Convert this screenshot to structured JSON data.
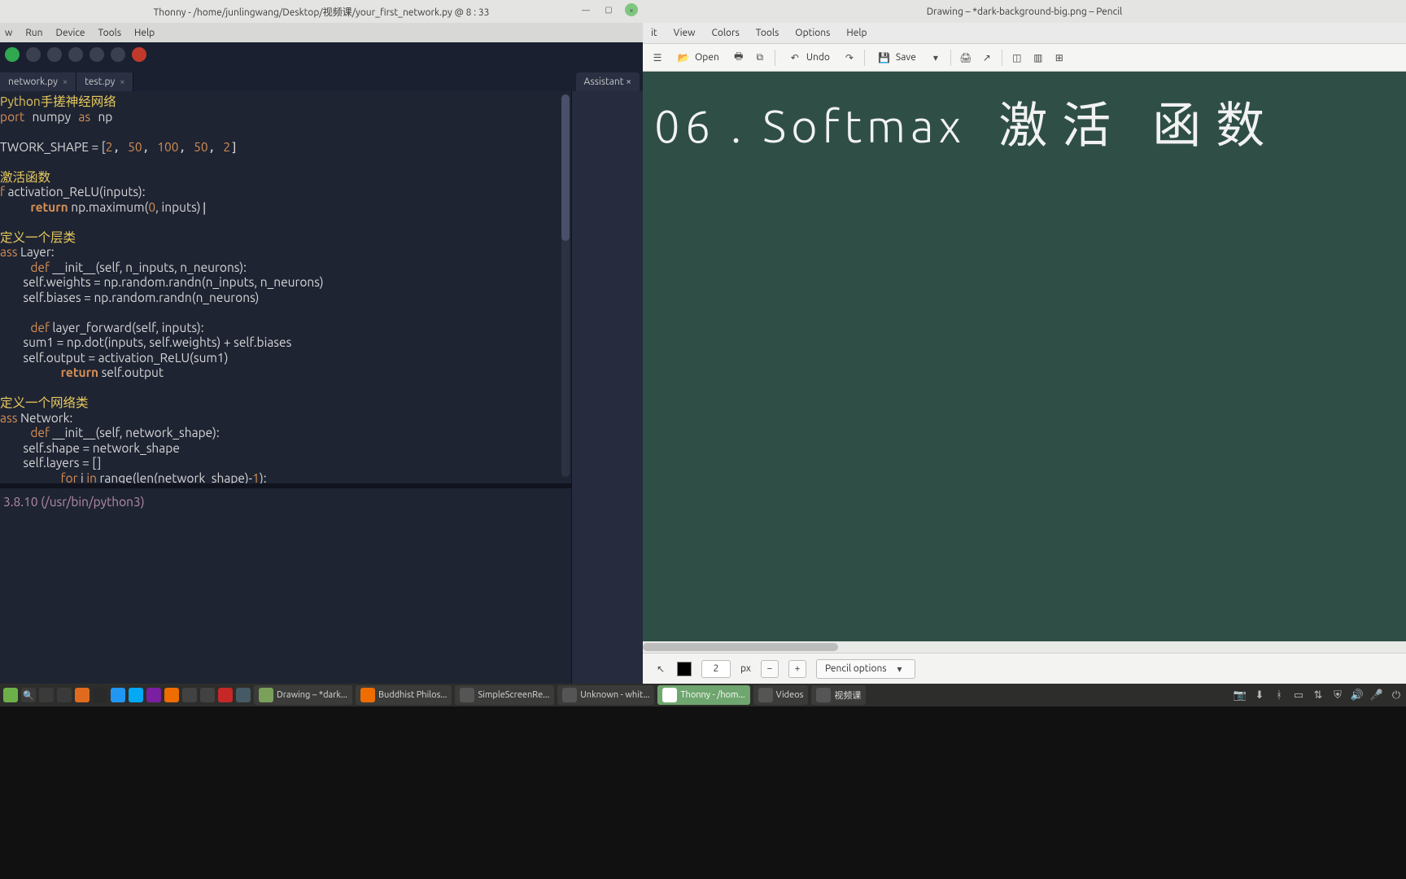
{
  "thonny": {
    "title": "Thonny  -  /home/junlingwang/Desktop/视频课/your_first_network.py  @  8 : 33",
    "menu": [
      "w",
      "Run",
      "Device",
      "Tools",
      "Help"
    ],
    "tabs": [
      {
        "label": "network.py",
        "closable": true
      },
      {
        "label": "test.py",
        "closable": true
      }
    ],
    "assistant_label": "Assistant",
    "code": {
      "l1_cmt": "Python手搓神经网络",
      "l2_a": "port",
      "l2_b": "numpy",
      "l2_c": "as",
      "l2_d": "np",
      "l3_a": "TWORK_SHAPE = [",
      "l3_n1": "2",
      "l3_n2": "50",
      "l3_n3": "100",
      "l3_n4": "50",
      "l3_n5": "2",
      "l4_cmt": "激活函数",
      "l5_a": "f",
      "l5_b": " activation_ReLU(inputs):",
      "l6_a": "return",
      "l6_b": " np.maximum(",
      "l6_n": "0",
      "l6_c": ", inputs)",
      "l7_cmt": "定义一个层类",
      "l8_a": "ass",
      "l8_b": " Layer:",
      "l9_a": "def",
      "l9_b": " __init__(self, n_inputs, n_neurons):",
      "l10": "        self.weights = np.random.randn(n_inputs, n_neurons)",
      "l11": "        self.biases = np.random.randn(n_neurons)",
      "l12_a": "def",
      "l12_b": " layer_forward(self, inputs):",
      "l13": "        sum1 = np.dot(inputs, self.weights) + self.biases",
      "l14": "        self.output = activation_ReLU(sum1)",
      "l15_a": "return",
      "l15_b": " self.output",
      "l16_cmt": "定义一个网络类",
      "l17_a": "ass",
      "l17_b": " Network:",
      "l18_a": "def",
      "l18_b": " __init__(self, network_shape):",
      "l19": "        self.shape = network_shape",
      "l20": "        self.layers = []",
      "l21_a": "for",
      "l21_b": " i ",
      "l21_c": "in",
      "l21_d": " range(len(network_shape)-",
      "l21_n": "1",
      "l21_e": "):"
    },
    "shell": "3.8.10 (/usr/bin/python3)"
  },
  "pencil": {
    "title": "Drawing – *dark-background-big.png – Pencil",
    "menu": [
      "it",
      "View",
      "Colors",
      "Tools",
      "Options",
      "Help"
    ],
    "toolbar": {
      "open": "Open",
      "undo": "Undo",
      "save": "Save"
    },
    "handwriting_num": "06 .",
    "handwriting_en": "Softmax",
    "handwriting_cn": "激活 函数",
    "footer": {
      "size": "2",
      "unit": "px",
      "options": "Pencil options"
    }
  },
  "taskbar": {
    "items": [
      {
        "label": "Drawing – *dark..."
      },
      {
        "label": "Buddhist Philos..."
      },
      {
        "label": "SimpleScreenRe..."
      },
      {
        "label": "Unknown - whit..."
      },
      {
        "label": "Thonny  -  /hom...",
        "active": true
      },
      {
        "label": "Videos"
      },
      {
        "label": "视频课"
      }
    ]
  }
}
